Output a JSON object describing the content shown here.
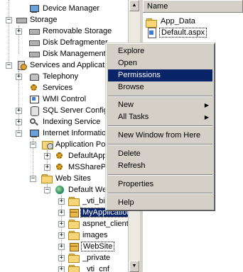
{
  "tree": {
    "device_manager": "Device Manager",
    "storage": "Storage",
    "removable_storage": "Removable Storage",
    "disk_defragmenter": "Disk Defragmenter",
    "disk_management": "Disk Management",
    "services_and_applications": "Services and Applications",
    "telephony": "Telephony",
    "services": "Services",
    "wmi_control": "WMI Control",
    "sql_server_config": "SQL Server Configuration Manager",
    "indexing_service": "Indexing Service",
    "iis": "Internet Information Services",
    "application_pools": "Application Pools",
    "default_app_pool": "DefaultAppPool",
    "mssharepoint": "MSSharePointAppPool",
    "web_sites": "Web Sites",
    "default_web_site": "Default Web Site",
    "vti_bin": "_vti_bin",
    "myapplication": "MyApplication",
    "aspnet_client": "aspnet_client",
    "images": "images",
    "website": "WebSite",
    "private": "_private",
    "vti_cnf": "_vti_cnf"
  },
  "right_pane": {
    "column_name": "Name",
    "items": [
      "App_Data",
      "Default.aspx"
    ]
  },
  "context_menu": {
    "explore": "Explore",
    "open": "Open",
    "permissions": "Permissions",
    "browse": "Browse",
    "new": "New",
    "all_tasks": "All Tasks",
    "new_window": "New Window from Here",
    "delete": "Delete",
    "refresh": "Refresh",
    "properties": "Properties",
    "help": "Help"
  },
  "colors": {
    "selection": "#0a246a",
    "menu_bg": "#d4d0c8"
  }
}
